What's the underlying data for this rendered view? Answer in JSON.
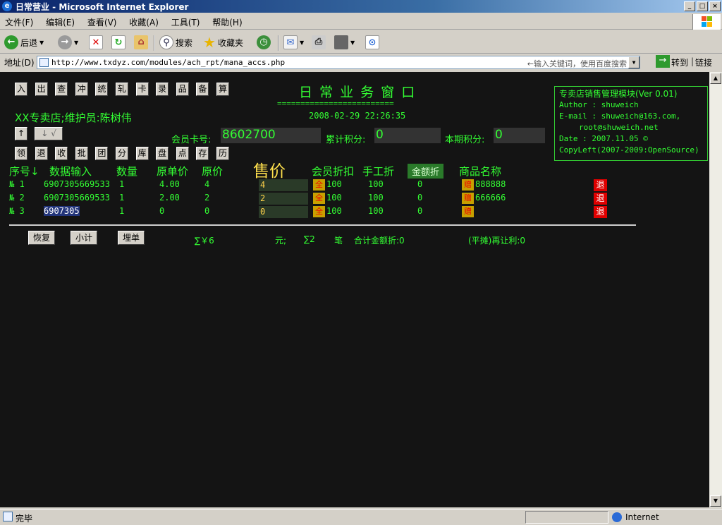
{
  "window": {
    "title": "日常营业 - Microsoft Internet Explorer"
  },
  "menu": [
    "文件(F)",
    "编辑(E)",
    "查看(V)",
    "收藏(A)",
    "工具(T)",
    "帮助(H)"
  ],
  "toolbar": {
    "back": "后退",
    "search": "搜索",
    "favorites": "收藏夹"
  },
  "address": {
    "label": "地址(D)",
    "url": "http://www.txdyz.com/modules/ach_rpt/mana_accs.php",
    "search_hint": "←输入关键词，使用百度搜索",
    "go": "转到",
    "links": "链接"
  },
  "page": {
    "keys_row1": [
      "入",
      "出",
      "查",
      "冲",
      "统",
      "轧",
      "卡",
      "录",
      "品",
      "备",
      "算"
    ],
    "keys_row2": [
      "领",
      "退",
      "收",
      "批",
      "团",
      "分",
      "库",
      "盘",
      "点",
      "存",
      "历"
    ],
    "arrow_up": "↑",
    "arrow_down": "↓ √",
    "title": "日 常 业 务 窗 口",
    "rule": "=========================",
    "datetime": "2008-02-29 22:26:35",
    "store": "XX专卖店;维护员:陈树伟",
    "member_card_label": "会员卡号:",
    "member_card": "8602700",
    "cum_points_label": "累计积分:",
    "cum_points": "0",
    "period_points_label": "本期积分:",
    "period_points": "0",
    "info": {
      "l1": "专卖店销售管理模块(Ver 0.01)",
      "l2": "Author : shuweich",
      "l3": "E-mail : shuweich@163.com,",
      "l4": "root@shuweich.net",
      "l5": "Date : 2007.11.05 ©",
      "l6": "CopyLeft(2007-2009:OpenSource)"
    },
    "headers": {
      "seq": "序号↓",
      "input": "数据输入",
      "qty": "数量",
      "unit": "原单价",
      "orig": "原价",
      "price": "售价",
      "member_disc": "会员折扣",
      "manual_disc": "手工折",
      "amount_disc": "金额折",
      "name": "商品名称"
    },
    "rows": [
      {
        "no": "№ 1",
        "code": "6907305669533",
        "qty": "1",
        "unit": "4.00",
        "orig": "4",
        "price": "4",
        "all": "全",
        "member": "100",
        "manual": "100",
        "amt": "0",
        "gift": "赠",
        "name": "888888",
        "ret": "退"
      },
      {
        "no": "№ 2",
        "code": "6907305669533",
        "qty": "1",
        "unit": "2.00",
        "orig": "2",
        "price": "2",
        "all": "全",
        "member": "100",
        "manual": "100",
        "amt": "0",
        "gift": "赠",
        "name": "666666",
        "ret": "退"
      },
      {
        "no": "№ 3",
        "code": "6907305",
        "qty": "1",
        "unit": "0",
        "orig": "0",
        "price": "0",
        "all": "全",
        "member": "100",
        "manual": "100",
        "amt": "0",
        "gift": "赠",
        "name": "",
        "ret": "退"
      }
    ],
    "buttons": {
      "restore": "恢复",
      "subtotal": "小计",
      "checkout": "埋单"
    },
    "summary": {
      "total": "∑￥6",
      "yuan": "元;",
      "count": "∑2",
      "bi": "笔",
      "amount_disc": "合计金额折:0",
      "profit": "(平摊)再让利:0"
    }
  },
  "status": {
    "text": "完毕",
    "zone": "Internet"
  }
}
